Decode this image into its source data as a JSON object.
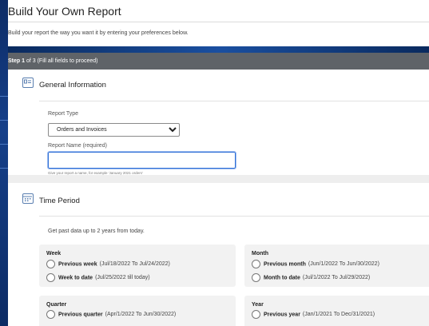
{
  "header": {
    "title": "Build Your Own Report",
    "intro": "Build your report the way you want it by entering your preferences below."
  },
  "step": {
    "label": "Step",
    "current": "1",
    "rest": "of 3 (Fill all fields to proceed)"
  },
  "general": {
    "title": "General Information",
    "icon": "id-card-icon",
    "report_type_label": "Report Type",
    "report_type_value": "Orders and Invoices",
    "report_name_label": "Report Name (required)",
    "report_name_value": "",
    "report_name_hint": "Give your report a name, for example 'January 2021 orders'"
  },
  "time_period": {
    "title": "Time Period",
    "icon": "calendar-icon",
    "note": "Get past data up to 2 years from today.",
    "groups": [
      {
        "title": "Week",
        "options": [
          {
            "label": "Previous week",
            "range": "(Jul/18/2022 To Jul/24/2022)"
          },
          {
            "label": "Week to date",
            "range": "(Jul/25/2022 till today)"
          }
        ]
      },
      {
        "title": "Month",
        "options": [
          {
            "label": "Previous month",
            "range": "(Jun/1/2022 To Jun/30/2022)"
          },
          {
            "label": "Month to date",
            "range": "(Jul/1/2022 To Jul/29/2022)"
          }
        ]
      },
      {
        "title": "Quarter",
        "options": [
          {
            "label": "Previous quarter",
            "range": "(Apr/1/2022 To Jun/30/2022)"
          }
        ]
      },
      {
        "title": "Year",
        "options": [
          {
            "label": "Previous year",
            "range": "(Jan/1/2021 To Dec/31/2021)"
          }
        ]
      }
    ]
  },
  "colors": {
    "step_bar": "#5f6368",
    "focus_blue": "#2f6fd6",
    "card_bg": "#f2f2f2",
    "desktop_blue": "#0f2f6b"
  }
}
